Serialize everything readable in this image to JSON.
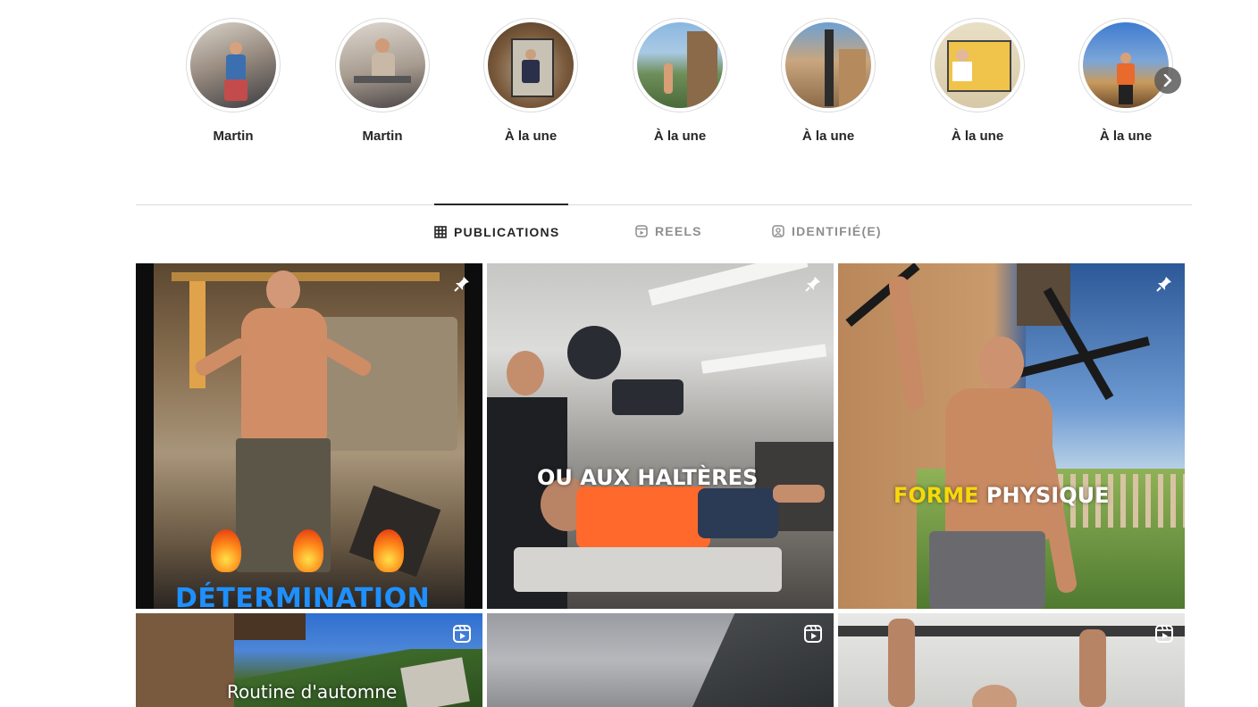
{
  "highlights": [
    {
      "label": "Martin"
    },
    {
      "label": "Martin"
    },
    {
      "label": "À la une"
    },
    {
      "label": "À la une"
    },
    {
      "label": "À la une"
    },
    {
      "label": "À la une"
    },
    {
      "label": "À la une"
    }
  ],
  "highlight_next_icon": "chevron-right-icon",
  "tabs": {
    "publications": "PUBLICATIONS",
    "reels": "REELS",
    "tagged": "IDENTIFIÉ(E)"
  },
  "posts": [
    {
      "overlay": "DÉTERMINATION",
      "badge": "pin-icon",
      "overlay_color": "#1e90ff"
    },
    {
      "overlay": "OU AUX HALTÈRES",
      "badge": "pin-icon",
      "overlay_color": "#ffffff"
    },
    {
      "overlay_part1": "FORME",
      "overlay_part2": "PHYSIQUE",
      "badge": "pin-icon",
      "overlay_color_1": "#f5d90a",
      "overlay_color_2": "#ffffff"
    },
    {
      "overlay": "Routine d'automne",
      "badge": "reel-icon"
    },
    {
      "overlay": "",
      "badge": "reel-icon"
    },
    {
      "overlay": "",
      "badge": "reel-icon"
    }
  ]
}
